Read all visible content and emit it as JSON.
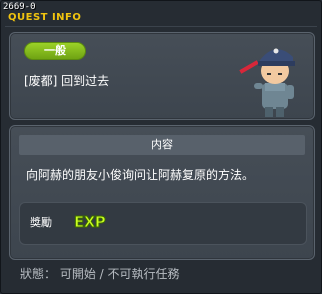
{
  "window": {
    "quest_id": "2669-0",
    "title": "QUEST INFO"
  },
  "header": {
    "category": "一般",
    "quest_name": "[废都] 回到过去",
    "npc_icon": "npc-police-figure"
  },
  "content": {
    "section_title": "内容",
    "description": "向阿赫的朋友小俊询问让阿赫复原的方法。"
  },
  "reward": {
    "label": "獎勵",
    "items": [
      "EXP"
    ]
  },
  "status": {
    "text": "狀態： 可開始 / 不可執行任務"
  },
  "colors": {
    "title": "#f1c40f",
    "category_pill": "#86bb1d",
    "exp_badge": "#ccff22"
  }
}
